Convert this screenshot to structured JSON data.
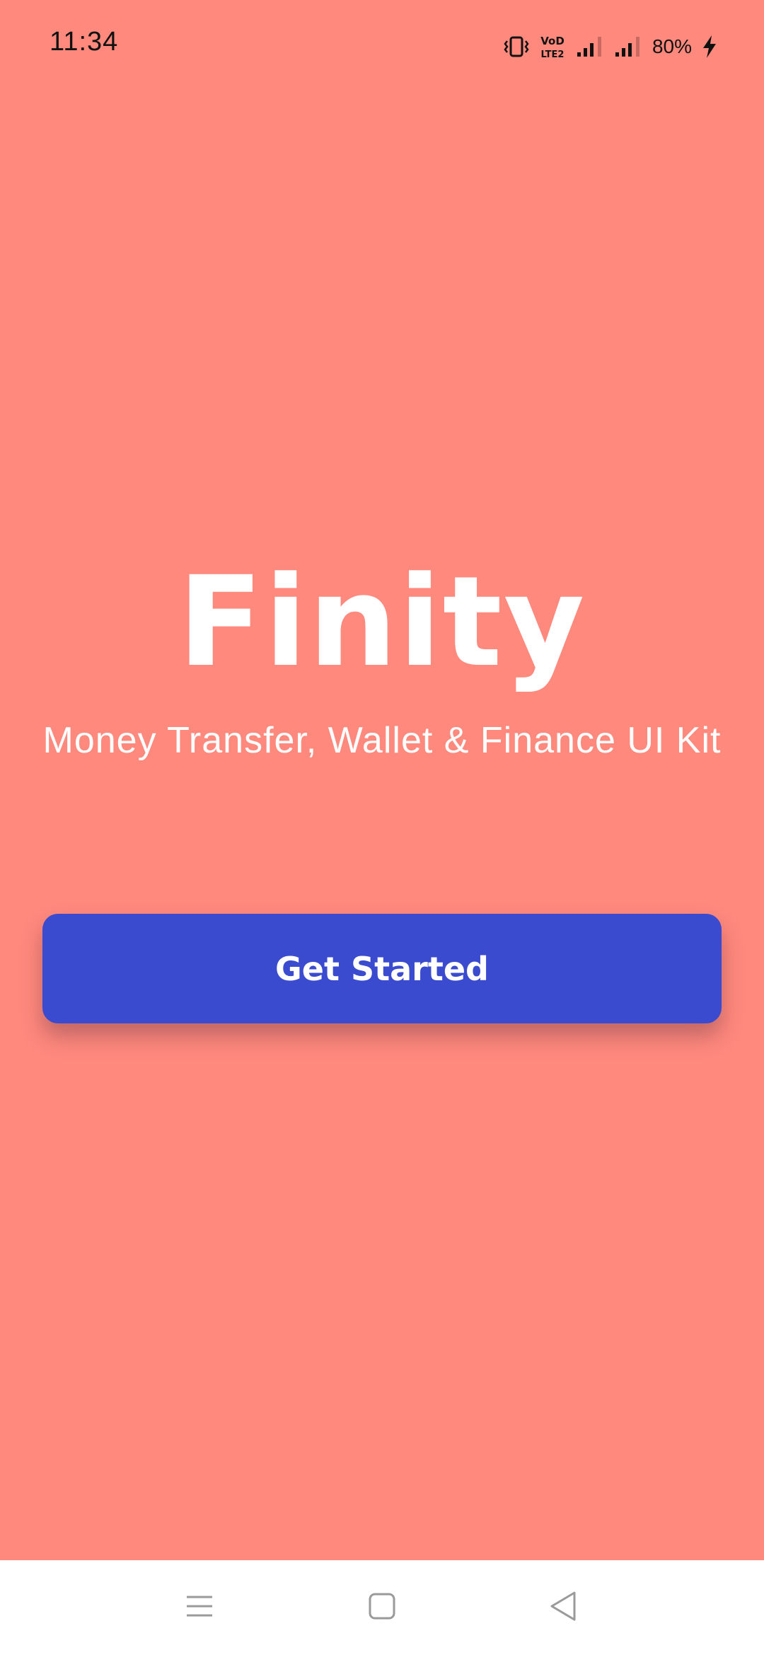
{
  "status_bar": {
    "time": "11:34",
    "battery_percent": "80%",
    "network_label_top": "VoD",
    "network_label_bottom": "LTE2",
    "icons": [
      "vibrate-icon",
      "volte-icon",
      "signal-icon",
      "signal-icon",
      "charging-icon"
    ]
  },
  "hero": {
    "title": "Finity",
    "subtitle": "Money Transfer, Wallet & Finance UI Kit"
  },
  "cta": {
    "label": "Get Started"
  },
  "nav_bar": {
    "icons": [
      "menu-icon",
      "home-icon",
      "back-icon"
    ]
  },
  "colors": {
    "background": "#FF897D",
    "button": "#3A4BD0",
    "text": "#FFFFFF",
    "nav_background": "#FFFFFF"
  }
}
